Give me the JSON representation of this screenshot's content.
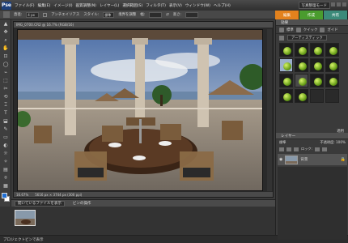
{
  "app": {
    "logo": "Pse",
    "menu": [
      "ファイル(F)",
      "編集(E)",
      "イメージ(I)",
      "画質調整(N)",
      "レイヤー(L)",
      "選択範囲(S)",
      "フィルタ(T)",
      "表示(V)",
      "ウィンドウ(W)",
      "ヘルプ(H)"
    ],
    "mode": "写真整理モード"
  },
  "options": {
    "size_label": "直径:",
    "size_value": "4 px",
    "antialias": "アンチエイリアス",
    "style_label": "スタイル:",
    "style_value": "標準",
    "refine": "境界を調整",
    "width_label": "幅:",
    "height_label": "高さ:"
  },
  "tabs": {
    "edit": "編集",
    "create": "作成",
    "share": "共有"
  },
  "toolbar": {
    "tools": [
      "▲",
      "✥",
      "⌕",
      "✋",
      "⊡",
      "◯",
      "⌁",
      "⬚",
      "✂",
      "⟲",
      "⌶",
      "T",
      "⬓",
      "✎",
      "▭",
      "◐",
      "☼",
      "✧",
      "▤",
      "⌾",
      "▦",
      "✚"
    ]
  },
  "document": {
    "title": "IMG_0700.CR2 @ 16.7% (RGB/16)",
    "zoom": "16.67%",
    "size": "5616 px × 3744 px (300 ppi)"
  },
  "bin": {
    "show_label": "開いているファイルを表示",
    "label2": "ビンの操作"
  },
  "status": {
    "text": "プロジェクトビンで表示"
  },
  "effects": {
    "header": "効果",
    "toolbar_labels": [
      "標準",
      "クイック",
      "ガイド"
    ],
    "dropdown": "アーティスティック",
    "apply": "適用",
    "cells": 16
  },
  "layers": {
    "header": "レイヤー",
    "mode_label": "標準",
    "opacity_label": "不透明度:",
    "opacity_value": "100%",
    "lock_label": "ロック:",
    "layer_name": "背景"
  }
}
